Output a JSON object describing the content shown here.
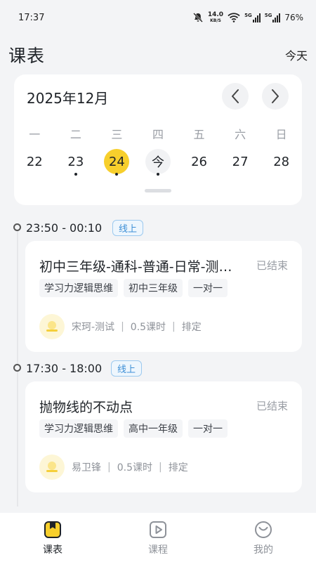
{
  "status_bar": {
    "time": "17:37",
    "net_speed_value": "14.0",
    "net_speed_unit": "KB/S",
    "sig1_label": "5G",
    "sig2_label": "5G",
    "battery": "76%"
  },
  "header": {
    "title": "课表",
    "today_link": "今天"
  },
  "calendar": {
    "month": "2025年12月",
    "weekdays": [
      "一",
      "二",
      "三",
      "四",
      "五",
      "六",
      "日"
    ],
    "dates": [
      {
        "label": "22",
        "dot": false
      },
      {
        "label": "23",
        "dot": true
      },
      {
        "label": "24",
        "dot": true,
        "selected": true
      },
      {
        "label": "今",
        "dot": true,
        "today": true
      },
      {
        "label": "26",
        "dot": false
      },
      {
        "label": "27",
        "dot": false
      },
      {
        "label": "28",
        "dot": false
      }
    ]
  },
  "lessons": [
    {
      "time": "23:50 - 00:10",
      "mode": "线上",
      "title": "初中三年级-通科-普通-日常-测试课程",
      "status": "已结束",
      "tags": [
        "学习力逻辑思维",
        "初中三年级",
        "一对一"
      ],
      "teacher": "宋珂-测试",
      "hours": "0.5课时",
      "schedule": "排定"
    },
    {
      "time": "17:30 - 18:00",
      "mode": "线上",
      "title": "抛物线的不动点",
      "status": "已结束",
      "tags": [
        "学习力逻辑思维",
        "高中一年级",
        "一对一"
      ],
      "teacher": "易卫锋",
      "hours": "0.5课时",
      "schedule": "排定"
    }
  ],
  "tabs": [
    {
      "label": "课表",
      "icon": "schedule-icon",
      "active": true
    },
    {
      "label": "课程",
      "icon": "play-icon",
      "active": false
    },
    {
      "label": "我的",
      "icon": "smile-icon",
      "active": false
    }
  ],
  "colors": {
    "accent": "#f7cf2c",
    "online_tag": "#3d8fd6"
  }
}
